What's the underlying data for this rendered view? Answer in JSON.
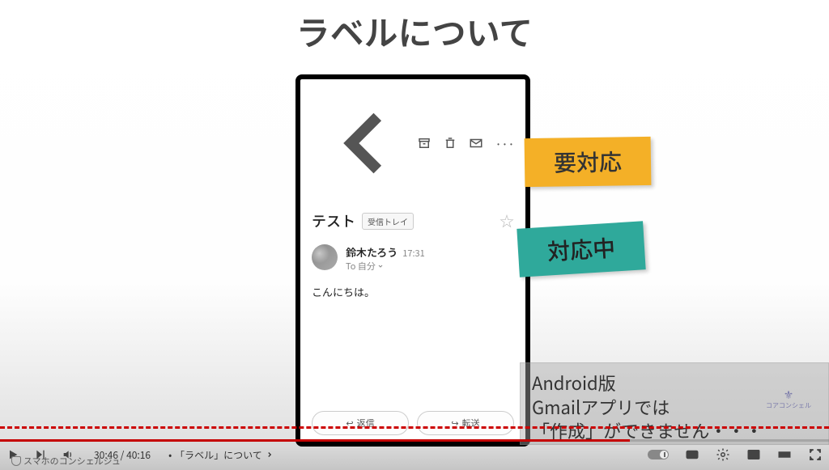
{
  "title": "ラベルについて",
  "phone": {
    "subject": "テスト",
    "inbox_chip": "受信トレイ",
    "sender_name": "鈴木たろう",
    "sender_time": "17:31",
    "sender_to": "To 自分",
    "body": "こんにちは。",
    "reply_label": "返信",
    "forward_label": "転送"
  },
  "labels": {
    "yellow": "要対応",
    "teal": "対応中"
  },
  "note": {
    "line1": "Android版",
    "line2": "Gmailアプリでは",
    "line3": "「作成」ができません・・・"
  },
  "small_logo": "コアコンシェル",
  "player": {
    "current": "30:46",
    "duration": "40:16",
    "chapter": "「ラベル」について"
  },
  "watermark": "スマホのコンシェルジュ"
}
